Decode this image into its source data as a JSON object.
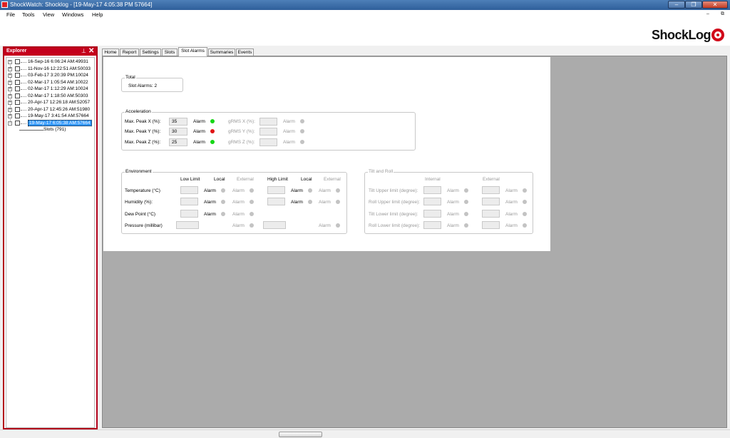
{
  "window": {
    "title": "ShockWatch: Shocklog - [19-May-17 4:05:38 PM  57664]",
    "controls": {
      "minimize": "–",
      "restore": "❐",
      "close": "✕"
    }
  },
  "menu": {
    "items": [
      "File",
      "Tools",
      "View",
      "Windows",
      "Help"
    ],
    "mdi_controls": {
      "minimize": "–",
      "restore": "⧉"
    }
  },
  "logo": {
    "text": "ShockLog"
  },
  "explorer": {
    "title": "Explorer",
    "pin_glyph": "⊥",
    "close_glyph": "✕",
    "items": [
      "16-Sep-16 6:06:24 AM:49931",
      "11-Nov-16 12:22:51 AM:50033",
      "03-Feb-17 3:20:39 PM:10024",
      "02-Mar-17 1:05:54 AM:10022",
      "02-Mar-17 1:12:29 AM:10024",
      "02-Mar-17 1:18:50 AM:50303",
      "20-Apr-17 12:26:18 AM:52057",
      "20-Apr-17 12:45:26 AM:51980",
      "19-May-17 3:41:54 AM:57664",
      "19-May-17 6:05:38 AM:57664"
    ],
    "selected_index": 9,
    "child": "Slots (791)"
  },
  "tabs": [
    "Home",
    "Report",
    "Settings",
    "Slots",
    "Slot Alarms",
    "Summaries",
    "Events"
  ],
  "active_tab": "Slot Alarms",
  "total": {
    "title": "Total",
    "text": "Slot Alarms: 2"
  },
  "acceleration": {
    "title": "Acceleration",
    "rows": [
      {
        "label": "Max. Peak X (%):",
        "value": "35",
        "alarm": "Alarm",
        "state": "green",
        "grms_label": "gRMS X (%):",
        "grms_alarm": "Alarm"
      },
      {
        "label": "Max. Peak Y (%):",
        "value": "30",
        "alarm": "Alarm",
        "state": "red",
        "grms_label": "gRMS Y (%):",
        "grms_alarm": "Alarm"
      },
      {
        "label": "Max. Peak Z (%):",
        "value": "25",
        "alarm": "Alarm",
        "state": "green",
        "grms_label": "gRMS Z (%):",
        "grms_alarm": "Alarm"
      }
    ]
  },
  "environment": {
    "title": "Environment",
    "headers": {
      "low_limit": "Low Limit",
      "local": "Local",
      "external": "External",
      "high_limit": "High Limit",
      "local2": "Local",
      "external2": "External"
    },
    "alarm": "Alarm",
    "rows": [
      "Temperature (°C)",
      "Humidity (%):",
      "Dew Point (°C)",
      "Pressure (millibar)"
    ]
  },
  "tilt": {
    "title": "Tilt and Roll",
    "headers": {
      "internal": "Internal",
      "external": "External"
    },
    "alarm": "Alarm",
    "rows": [
      "Tilt Upper limit (degree):",
      "Roll Upper limit (degree):",
      "Tilt Lower limit (degree):",
      "Roll Lower limit (degree):"
    ]
  }
}
